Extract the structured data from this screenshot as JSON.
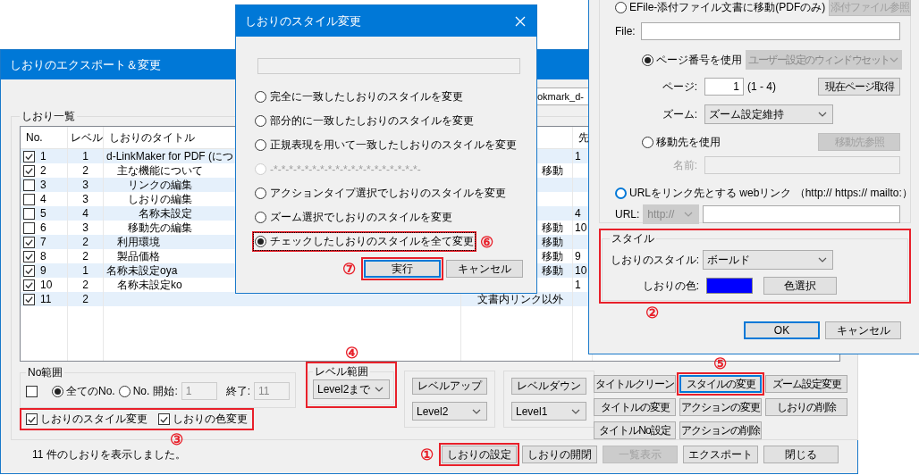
{
  "main_window": {
    "title": "しおりのエクスポート＆変更",
    "file_field": "okmark_d-",
    "list_label": "しおり一覧",
    "columns": [
      "No.",
      "レベル",
      "しおりのタイトル",
      "先"
    ],
    "rows": [
      {
        "checked": true,
        "no": "1",
        "level_label": "1",
        "title": "d-LinkMaker for PDF (につ",
        "first": "1"
      },
      {
        "checked": true,
        "no": "2",
        "level_label": "2",
        "title": "主な機能について",
        "action": "移動"
      },
      {
        "checked": false,
        "no": "3",
        "level_label": "3",
        "title": "リンクの編集"
      },
      {
        "checked": false,
        "no": "4",
        "level_label": "3",
        "title": "しおりの編集"
      },
      {
        "checked": false,
        "no": "5",
        "level_label": "4",
        "title": "名称未設定",
        "first": "4"
      },
      {
        "checked": false,
        "no": "6",
        "level_label": "3",
        "title": "移動先の編集",
        "action": "移動",
        "first": "10"
      },
      {
        "checked": true,
        "no": "7",
        "level_label": "2",
        "title": "利用環境",
        "action": "移動"
      },
      {
        "checked": true,
        "no": "8",
        "level_label": "2",
        "title": "製品価格",
        "action": "移動",
        "first": "9"
      },
      {
        "checked": true,
        "no": "9",
        "level_label": "1",
        "title": "名称未設定oya",
        "action": "移動",
        "first": "10"
      },
      {
        "checked": true,
        "no": "10",
        "level_label": "2",
        "title": "名称未設定ko",
        "first": "1"
      },
      {
        "checked": true,
        "no": "11",
        "level_label": "2",
        "action": "文書内リンク以外"
      }
    ],
    "no_range": {
      "label": "No範囲",
      "checked": false,
      "options": [
        {
          "label": "全てのNo.",
          "selected": true
        },
        {
          "label": "No.",
          "selected": false
        }
      ],
      "start_label": "開始:",
      "start": "1",
      "end_label": "終了:",
      "end": "11"
    },
    "change_options": {
      "highlighted": true,
      "badge": "③",
      "items": [
        {
          "label": "しおりのスタイル変更",
          "checked": true
        },
        {
          "label": "しおりの色変更",
          "checked": true
        }
      ]
    },
    "level_range": {
      "label": "レベル範囲",
      "value": "Level2まで",
      "highlighted": true,
      "badge": "④"
    },
    "level_up": {
      "button": "レベルアップ",
      "value": "Level2"
    },
    "level_down": {
      "button": "レベルダウン",
      "value": "Level1"
    },
    "actions": [
      {
        "label": "タイトルクリーン",
        "focused": false,
        "highlighted": false
      },
      {
        "label": "スタイルの変更",
        "focused": true,
        "highlighted": true,
        "badge": "⑤"
      },
      {
        "label": "ズーム設定変更",
        "focused": false,
        "highlighted": false
      },
      {
        "label": "タイトルの変更",
        "focused": false,
        "highlighted": false
      },
      {
        "label": "アクションの変更",
        "focused": false,
        "highlighted": false
      },
      {
        "label": "しおりの削除",
        "focused": false,
        "highlighted": false
      },
      {
        "label": "タイトルNo設定",
        "focused": false,
        "highlighted": false
      },
      {
        "label": "アクションの削除",
        "focused": false,
        "highlighted": false
      }
    ],
    "status": "11 件のしおりを表示しました。",
    "footer_buttons": [
      {
        "label": "しおりの設定",
        "disabled": false,
        "highlighted": true,
        "badge": "①"
      },
      {
        "label": "しおりの開閉",
        "disabled": false,
        "highlighted": false
      },
      {
        "label": "一覧表示",
        "disabled": true,
        "highlighted": false
      },
      {
        "label": "エクスポート",
        "disabled": false,
        "highlighted": false
      },
      {
        "label": "閉じる",
        "disabled": false,
        "highlighted": false
      }
    ]
  },
  "style_dialog": {
    "title": "しおりのスタイル変更",
    "pattern_field": {
      "disabled": true
    },
    "options": [
      {
        "label": "完全に一致したしおりのスタイルを変更",
        "selected": false,
        "disabled": false,
        "highlighted": false
      },
      {
        "label": "部分的に一致したしおりのスタイルを変更",
        "selected": false,
        "disabled": false,
        "highlighted": false
      },
      {
        "label": "正規表現を用いて一致したしおりのスタイルを変更",
        "selected": false,
        "disabled": false,
        "highlighted": false
      },
      {
        "label": "-*-*-*-*-*-*-*-*-*-*-*-*-*-*-*-*-*-*-*-",
        "selected": false,
        "disabled": true,
        "highlighted": false
      },
      {
        "label": "アクションタイプ選択でしおりのスタイルを変更",
        "selected": false,
        "disabled": false,
        "highlighted": false
      },
      {
        "label": "ズーム選択でしおりのスタイルを変更",
        "selected": false,
        "disabled": false,
        "highlighted": false
      },
      {
        "label": "チェックしたしおりのスタイルを全て変更",
        "selected": true,
        "disabled": false,
        "highlighted": true,
        "badge": "⑥"
      }
    ],
    "buttons": [
      {
        "label": "実行",
        "focused": true,
        "highlighted": true,
        "badge": "⑦"
      },
      {
        "label": "キャンセル",
        "focused": false,
        "highlighted": false
      }
    ]
  },
  "link_dialog": {
    "efile": {
      "label": "EFile-添付ファイル文書に移動(PDFのみ)",
      "selected": false,
      "hovered": false,
      "button": {
        "label": "添付ファイル参照",
        "disabled": true
      }
    },
    "file_label": "File:",
    "page": {
      "label": "ページ番号を使用",
      "selected": true,
      "hovered": false,
      "window_dropdown": {
        "value": "ユーザー設定のウィンドウセット",
        "disabled": true
      },
      "page_label": "ページ:",
      "page_value": "1",
      "page_range": "(1 - 4)",
      "current_button": {
        "label": "現在ページ取得",
        "disabled": false
      },
      "zoom_label": "ズーム:",
      "zoom_value": "ズーム設定維持"
    },
    "dest": {
      "label": "移動先を使用",
      "selected": false,
      "hovered": false,
      "button": {
        "label": "移動先参照",
        "disabled": true
      },
      "name_label": "名前:"
    },
    "url": {
      "label": "URLをリンク先とする webリンク （http:// https:// mailto:）",
      "selected": false,
      "hovered": true,
      "url_label": "URL:",
      "scheme": {
        "value": "http://",
        "disabled": true
      }
    },
    "style_group": {
      "label": "スタイル",
      "highlighted": true,
      "badge": "②",
      "style_label": "しおりのスタイル:",
      "style_value": "ボールド",
      "color_label": "しおりの色:",
      "color": "#0000ff",
      "color_button": "色選択"
    },
    "buttons": [
      {
        "label": "OK",
        "focused": true
      },
      {
        "label": "キャンセル",
        "focused": false
      }
    ]
  }
}
